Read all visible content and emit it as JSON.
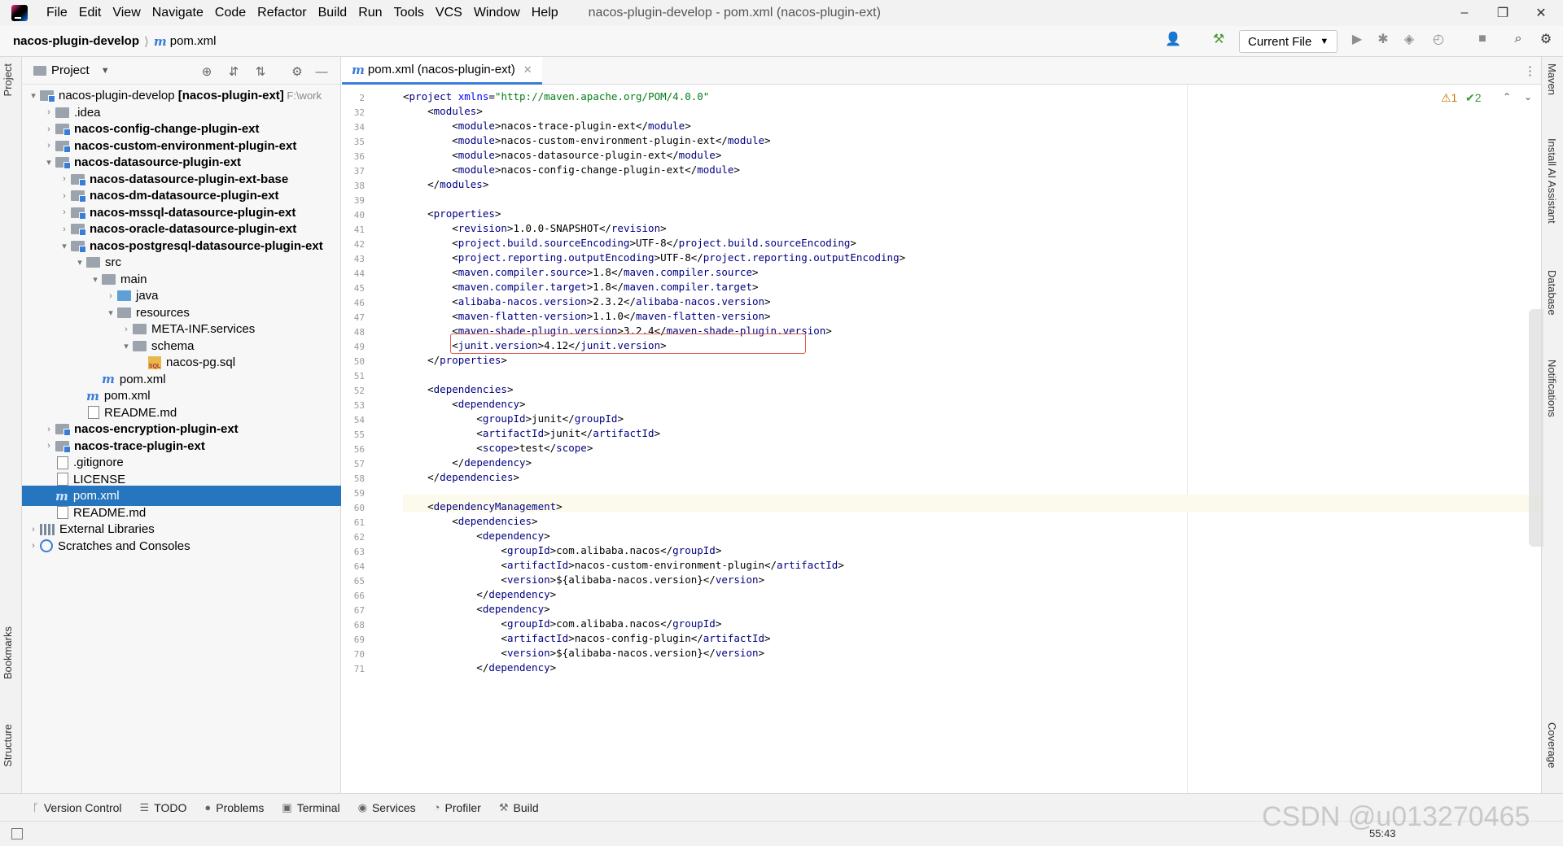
{
  "titlebar": {
    "menu": [
      "File",
      "Edit",
      "View",
      "Navigate",
      "Code",
      "Refactor",
      "Build",
      "Run",
      "Tools",
      "VCS",
      "Window",
      "Help"
    ],
    "window_title": "nacos-plugin-develop - pom.xml (nacos-plugin-ext)",
    "minimize": "–",
    "maximize": "❐",
    "close": "✕"
  },
  "navbar": {
    "project": "nacos-plugin-develop",
    "separator": "⟩",
    "file_icon": "m",
    "file": "pom.xml",
    "run_config": "Current File"
  },
  "project_panel": {
    "title": "Project",
    "tree": [
      {
        "indent": 0,
        "chev": "▾",
        "icon": "module-folder",
        "label": "nacos-plugin-develop",
        "bold_suffix": " [nacos-plugin-ext]",
        "muted": " F:\\work"
      },
      {
        "indent": 1,
        "chev": "›",
        "icon": "folder",
        "label": ".idea"
      },
      {
        "indent": 1,
        "chev": "›",
        "icon": "module-folder",
        "label": "nacos-config-change-plugin-ext",
        "bold": true
      },
      {
        "indent": 1,
        "chev": "›",
        "icon": "module-folder",
        "label": "nacos-custom-environment-plugin-ext",
        "bold": true
      },
      {
        "indent": 1,
        "chev": "▾",
        "icon": "module-folder",
        "label": "nacos-datasource-plugin-ext",
        "bold": true
      },
      {
        "indent": 2,
        "chev": "›",
        "icon": "module-folder",
        "label": "nacos-datasource-plugin-ext-base",
        "bold": true
      },
      {
        "indent": 2,
        "chev": "›",
        "icon": "module-folder",
        "label": "nacos-dm-datasource-plugin-ext",
        "bold": true
      },
      {
        "indent": 2,
        "chev": "›",
        "icon": "module-folder",
        "label": "nacos-mssql-datasource-plugin-ext",
        "bold": true
      },
      {
        "indent": 2,
        "chev": "›",
        "icon": "module-folder",
        "label": "nacos-oracle-datasource-plugin-ext",
        "bold": true
      },
      {
        "indent": 2,
        "chev": "▾",
        "icon": "module-folder",
        "label": "nacos-postgresql-datasource-plugin-ext",
        "bold": true
      },
      {
        "indent": 3,
        "chev": "▾",
        "icon": "folder",
        "label": "src"
      },
      {
        "indent": 4,
        "chev": "▾",
        "icon": "folder",
        "label": "main"
      },
      {
        "indent": 5,
        "chev": "›",
        "icon": "java-folder",
        "label": "java"
      },
      {
        "indent": 5,
        "chev": "▾",
        "icon": "resources-folder",
        "label": "resources"
      },
      {
        "indent": 6,
        "chev": "›",
        "icon": "folder",
        "label": "META-INF.services"
      },
      {
        "indent": 6,
        "chev": "▾",
        "icon": "folder",
        "label": "schema"
      },
      {
        "indent": 7,
        "chev": "",
        "icon": "sql-file",
        "label": "nacos-pg.sql"
      },
      {
        "indent": 4,
        "chev": "",
        "icon": "maven-file",
        "label": "pom.xml"
      },
      {
        "indent": 3,
        "chev": "",
        "icon": "maven-file",
        "label": "pom.xml"
      },
      {
        "indent": 3,
        "chev": "",
        "icon": "text-file",
        "label": "README.md"
      },
      {
        "indent": 1,
        "chev": "›",
        "icon": "module-folder",
        "label": "nacos-encryption-plugin-ext",
        "bold": true
      },
      {
        "indent": 1,
        "chev": "›",
        "icon": "module-folder",
        "label": "nacos-trace-plugin-ext",
        "bold": true
      },
      {
        "indent": 1,
        "chev": "",
        "icon": "text-file",
        "label": ".gitignore"
      },
      {
        "indent": 1,
        "chev": "",
        "icon": "text-file",
        "label": "LICENSE"
      },
      {
        "indent": 1,
        "chev": "",
        "icon": "maven-file",
        "label": "pom.xml",
        "selected": true
      },
      {
        "indent": 1,
        "chev": "",
        "icon": "text-file",
        "label": "README.md"
      },
      {
        "indent": 0,
        "chev": "›",
        "icon": "library",
        "label": "External Libraries"
      },
      {
        "indent": 0,
        "chev": "›",
        "icon": "scratch",
        "label": "Scratches and Consoles"
      }
    ]
  },
  "editor": {
    "tab_icon": "m",
    "tab_label": "pom.xml (nacos-plugin-ext)",
    "inspections_warn": "⚠1",
    "inspections_ok": "✔2",
    "lines": [
      {
        "n": "2",
        "t": "<project xmlns=\"http://maven.apache.org/POM/4.0.0\""
      },
      {
        "n": "32",
        "t": "    <modules>"
      },
      {
        "n": "34",
        "t": "        <module>nacos-trace-plugin-ext</module>"
      },
      {
        "n": "35",
        "t": "        <module>nacos-custom-environment-plugin-ext</module>"
      },
      {
        "n": "36",
        "t": "        <module>nacos-datasource-plugin-ext</module>"
      },
      {
        "n": "37",
        "t": "        <module>nacos-config-change-plugin-ext</module>"
      },
      {
        "n": "38",
        "t": "    </modules>"
      },
      {
        "n": "39",
        "t": ""
      },
      {
        "n": "40",
        "t": "    <properties>"
      },
      {
        "n": "41",
        "t": "        <revision>1.0.0-SNAPSHOT</revision>"
      },
      {
        "n": "42",
        "t": "        <project.build.sourceEncoding>UTF-8</project.build.sourceEncoding>"
      },
      {
        "n": "43",
        "t": "        <project.reporting.outputEncoding>UTF-8</project.reporting.outputEncoding>"
      },
      {
        "n": "44",
        "t": "        <maven.compiler.source>1.8</maven.compiler.source>"
      },
      {
        "n": "45",
        "t": "        <maven.compiler.target>1.8</maven.compiler.target>"
      },
      {
        "n": "46",
        "t": "        <alibaba-nacos.version>2.3.2</alibaba-nacos.version>"
      },
      {
        "n": "47",
        "t": "        <maven-flatten-version>1.1.0</maven-flatten-version>"
      },
      {
        "n": "48",
        "t": "        <maven-shade-plugin.version>3.2.4</maven-shade-plugin.version>"
      },
      {
        "n": "49",
        "t": "        <junit.version>4.12</junit.version>"
      },
      {
        "n": "50",
        "t": "    </properties>"
      },
      {
        "n": "51",
        "t": ""
      },
      {
        "n": "52",
        "t": "    <dependencies>"
      },
      {
        "n": "53",
        "t": "        <dependency>"
      },
      {
        "n": "54",
        "t": "            <groupId>junit</groupId>"
      },
      {
        "n": "55",
        "t": "            <artifactId>junit</artifactId>"
      },
      {
        "n": "56",
        "t": "            <scope>test</scope>"
      },
      {
        "n": "57",
        "t": "        </dependency>"
      },
      {
        "n": "58",
        "t": "    </dependencies>"
      },
      {
        "n": "59",
        "t": ""
      },
      {
        "n": "60",
        "t": "    <dependencyManagement>"
      },
      {
        "n": "61",
        "t": "        <dependencies>"
      },
      {
        "n": "62",
        "t": "            <dependency>"
      },
      {
        "n": "63",
        "t": "                <groupId>com.alibaba.nacos</groupId>"
      },
      {
        "n": "64",
        "t": "                <artifactId>nacos-custom-environment-plugin</artifactId>"
      },
      {
        "n": "65",
        "t": "                <version>${alibaba-nacos.version}</version>"
      },
      {
        "n": "66",
        "t": "            </dependency>"
      },
      {
        "n": "67",
        "t": "            <dependency>"
      },
      {
        "n": "68",
        "t": "                <groupId>com.alibaba.nacos</groupId>"
      },
      {
        "n": "69",
        "t": "                <artifactId>nacos-config-plugin</artifactId>"
      },
      {
        "n": "70",
        "t": "                <version>${alibaba-nacos.version}</version>"
      },
      {
        "n": "71",
        "t": "            </dependency>"
      }
    ]
  },
  "left_strip": {
    "project": "Project",
    "bookmarks": "Bookmarks",
    "structure": "Structure"
  },
  "right_strip": {
    "maven": "Maven",
    "ai": "Install AI Assistant",
    "database": "Database",
    "notifications": "Notifications",
    "coverage": "Coverage"
  },
  "bottom_tools": [
    {
      "icon": "branch-icon",
      "glyph": "ᚴ",
      "label": "Version Control"
    },
    {
      "icon": "todo-icon",
      "glyph": "☰",
      "label": "TODO"
    },
    {
      "icon": "problems-icon",
      "glyph": "●",
      "label": "Problems"
    },
    {
      "icon": "terminal-icon",
      "glyph": "▣",
      "label": "Terminal"
    },
    {
      "icon": "services-icon",
      "glyph": "◉",
      "label": "Services"
    },
    {
      "icon": "profiler-icon",
      "glyph": "◔",
      "label": "Profiler"
    },
    {
      "icon": "build-icon",
      "glyph": "⚒",
      "label": "Build"
    }
  ],
  "status": {
    "position": "55:43"
  },
  "watermark": "CSDN @u013270465",
  "colors": {
    "selection": "#2675bf",
    "tag": "#000080",
    "string": "#067d17",
    "highlight_box": "#e35b4f",
    "match_tag": "#aee3e6"
  }
}
